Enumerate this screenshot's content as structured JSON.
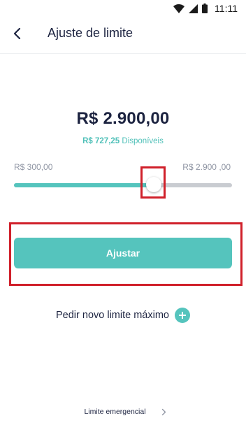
{
  "status_bar": {
    "time": "11:11"
  },
  "header": {
    "title": "Ajuste de limite"
  },
  "limit": {
    "value": "R$ 2.900,00",
    "available_amount": "R$ 727,25",
    "available_label": "Disponíveis"
  },
  "slider": {
    "min_label": "R$ 300,00",
    "max_label": "R$ 2.900 ,00",
    "level": 0.64
  },
  "actions": {
    "adjust_label": "Ajustar",
    "new_limit_label": "Pedir novo limite máximo",
    "emergency_label": "Limite emergencial"
  },
  "colors": {
    "accent": "#55c4bd",
    "text": "#1c2340",
    "track": "#c9ccd1",
    "highlight": "#d0202a"
  },
  "icons": {
    "back": "arrow-back-icon",
    "add": "plus-icon",
    "next": "chevron-right-icon"
  }
}
